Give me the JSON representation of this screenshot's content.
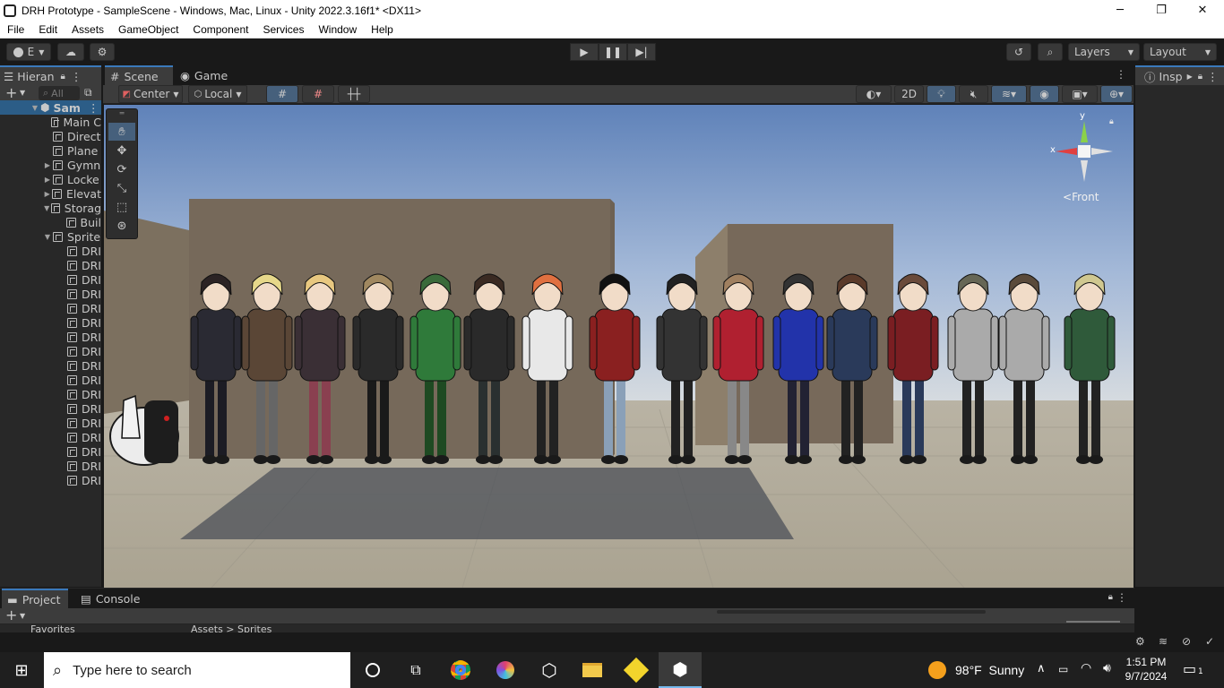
{
  "window": {
    "title": "DRH Prototype - SampleScene - Windows, Mac, Linux - Unity 2022.3.16f1* <DX11>",
    "minimize": "─",
    "maximize": "❐",
    "close": "✕"
  },
  "menu": [
    "File",
    "Edit",
    "Assets",
    "GameObject",
    "Component",
    "Services",
    "Window",
    "Help"
  ],
  "toolbar": {
    "account_label": "E",
    "layers_label": "Layers",
    "layout_label": "Layout"
  },
  "hierarchy": {
    "tab_label": "Hieran",
    "search_placeholder": "All",
    "scene_name": "Sam",
    "items": [
      {
        "label": "Main C",
        "indent": 1,
        "arrow": ""
      },
      {
        "label": "Direct",
        "indent": 1,
        "arrow": ""
      },
      {
        "label": "Plane",
        "indent": 1,
        "arrow": ""
      },
      {
        "label": "Gymn",
        "indent": 1,
        "arrow": "▶"
      },
      {
        "label": "Locke",
        "indent": 1,
        "arrow": "▶"
      },
      {
        "label": "Elevat",
        "indent": 1,
        "arrow": "▶"
      },
      {
        "label": "Storag",
        "indent": 1,
        "arrow": "▼"
      },
      {
        "label": "Buil",
        "indent": 2,
        "arrow": ""
      },
      {
        "label": "Sprite",
        "indent": 1,
        "arrow": "▼"
      },
      {
        "label": "DRI",
        "indent": 2,
        "arrow": ""
      },
      {
        "label": "DRI",
        "indent": 2,
        "arrow": ""
      },
      {
        "label": "DRI",
        "indent": 2,
        "arrow": ""
      },
      {
        "label": "DRI",
        "indent": 2,
        "arrow": ""
      },
      {
        "label": "DRI",
        "indent": 2,
        "arrow": ""
      },
      {
        "label": "DRI",
        "indent": 2,
        "arrow": ""
      },
      {
        "label": "DRI",
        "indent": 2,
        "arrow": ""
      },
      {
        "label": "DRI",
        "indent": 2,
        "arrow": ""
      },
      {
        "label": "DRI",
        "indent": 2,
        "arrow": ""
      },
      {
        "label": "DRI",
        "indent": 2,
        "arrow": ""
      },
      {
        "label": "DRI",
        "indent": 2,
        "arrow": ""
      },
      {
        "label": "DRI",
        "indent": 2,
        "arrow": ""
      },
      {
        "label": "DRI",
        "indent": 2,
        "arrow": ""
      },
      {
        "label": "DRI",
        "indent": 2,
        "arrow": ""
      },
      {
        "label": "DRI",
        "indent": 2,
        "arrow": ""
      },
      {
        "label": "DRI",
        "indent": 2,
        "arrow": ""
      },
      {
        "label": "DRI",
        "indent": 2,
        "arrow": ""
      }
    ]
  },
  "scene": {
    "tab_scene": "Scene",
    "tab_game": "Game",
    "pivot_label": "Center",
    "space_label": "Local",
    "mode_2d": "2D",
    "gizmo_view": "Front",
    "axis_y": "y",
    "axis_x": "x"
  },
  "inspector": {
    "tab_label": "Insp"
  },
  "bottom": {
    "tab_project": "Project",
    "tab_console": "Console",
    "favorites": "Favorites",
    "breadcrumb": "Assets > Sprites"
  },
  "taskbar": {
    "search_placeholder": "Type here to search",
    "weather": "98°F  Sunny",
    "time": "1:51 PM",
    "date": "9/7/2024",
    "notification_count": "1"
  },
  "colors": {
    "accent": "#3a79bb",
    "panel": "#282828",
    "tab_active": "#3c3c3c",
    "sky_top": "#6d8dbf",
    "ground": "#b0a896"
  }
}
